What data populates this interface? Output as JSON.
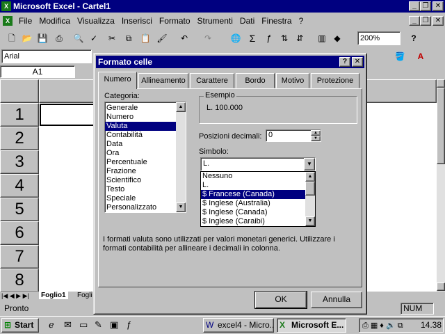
{
  "app": {
    "title": "Microsoft Excel - Cartel1",
    "menu": [
      "File",
      "Modifica",
      "Visualizza",
      "Inserisci",
      "Formato",
      "Strumenti",
      "Dati",
      "Finestra",
      "?"
    ],
    "zoom": "200%",
    "font_name": "Arial",
    "name_box": "A1",
    "rows": [
      "1",
      "2",
      "3",
      "4",
      "5",
      "6",
      "7",
      "8"
    ],
    "sheet_tabs": [
      "Foglio1",
      "Fogli"
    ],
    "status_left": "Pronto",
    "status_num": "NUM"
  },
  "dialog": {
    "title": "Formato celle",
    "help_btn": "?",
    "close_btn": "✕",
    "tabs": [
      "Numero",
      "Allineamento",
      "Carattere",
      "Bordo",
      "Motivo",
      "Protezione"
    ],
    "active_tab": "Numero",
    "category_label": "Categoria:",
    "categories": [
      "Generale",
      "Numero",
      "Valuta",
      "Contabilità",
      "Data",
      "Ora",
      "Percentuale",
      "Frazione",
      "Scientifico",
      "Testo",
      "Speciale",
      "Personalizzato"
    ],
    "selected_category": "Valuta",
    "sample_label": "Esempio",
    "sample_value": "L. 100.000",
    "decimals_label": "Posizioni decimali:",
    "decimals_value": "0",
    "symbol_label": "Simbolo:",
    "symbol_value": "L.",
    "symbol_options": [
      "Nessuno",
      "L.",
      "$ Francese (Canada)",
      "$ Inglese (Australia)",
      "$ Inglese (Canada)",
      "$ Inglese (Caraibi)"
    ],
    "selected_symbol": "$ Francese (Canada)",
    "description": "I formati valuta sono utilizzati per valori  monetari generici. Utilizzare i formati contabilità per allineare i decimali in colonna.",
    "ok_label": "OK",
    "cancel_label": "Annulla"
  },
  "taskbar": {
    "start_label": "Start",
    "tasks": [
      "excel4 - Micro...",
      "Microsoft E..."
    ],
    "clock": "14.38"
  }
}
